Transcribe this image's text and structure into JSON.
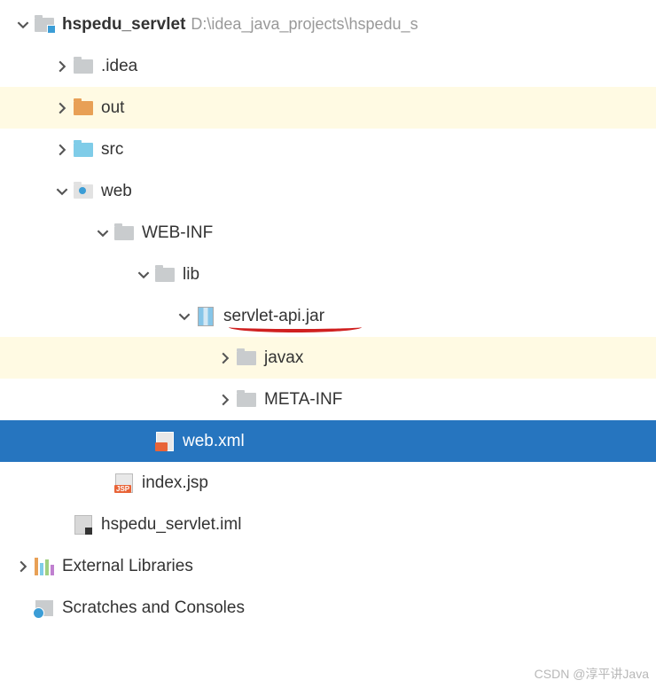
{
  "root": {
    "name": "hspedu_servlet",
    "path": "D:\\idea_java_projects\\hspedu_s"
  },
  "children": {
    "idea": ".idea",
    "out": "out",
    "src": "src",
    "web": "web",
    "webinf": "WEB-INF",
    "lib": "lib",
    "servletapi": "servlet-api.jar",
    "javax": "javax",
    "metainf": "META-INF",
    "webxml": "web.xml",
    "indexjsp": "index.jsp",
    "iml": "hspedu_servlet.iml"
  },
  "extLibs": "External Libraries",
  "scratches": "Scratches and Consoles",
  "watermark": "CSDN @淳平讲Java"
}
